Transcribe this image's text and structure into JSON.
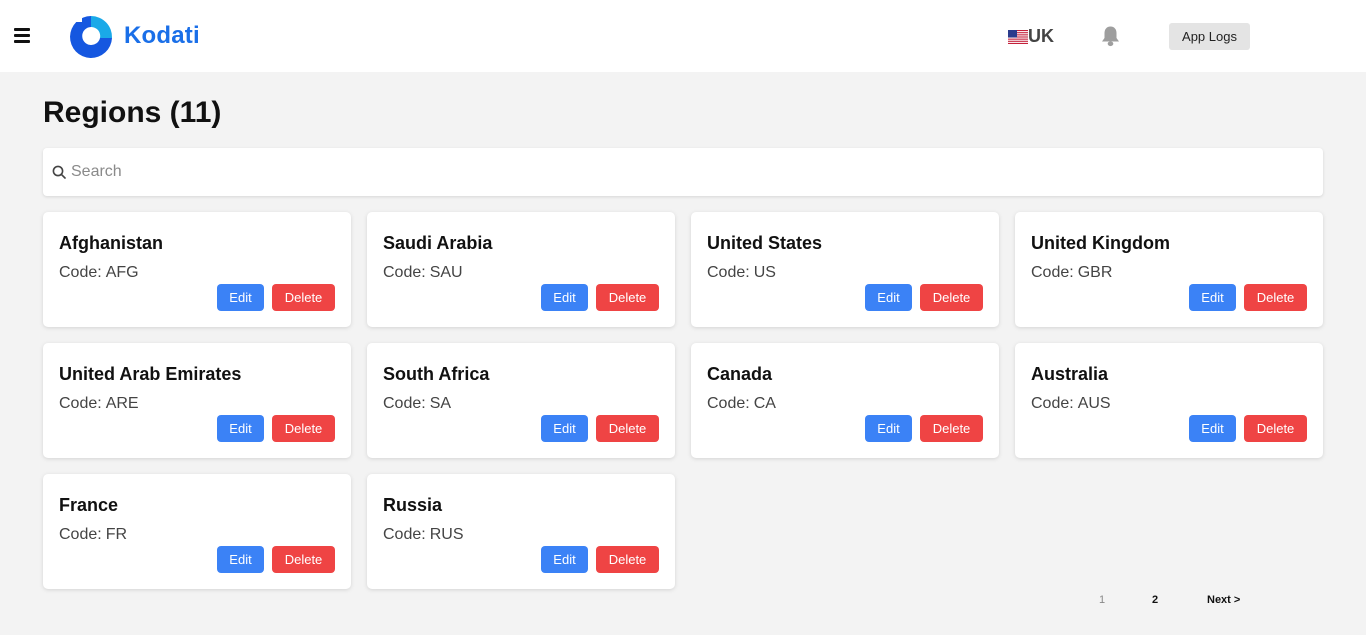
{
  "header": {
    "logo_text": "Kodati",
    "language_label": "UK",
    "app_logs_label": "App Logs",
    "icons": {
      "menu": "hamburger-menu-icon",
      "flag": "us-flag-icon",
      "notifications": "bell-icon"
    },
    "brand_color": "#1a6fe8"
  },
  "page": {
    "title": "Regions (11)"
  },
  "search": {
    "placeholder": "Search",
    "value": ""
  },
  "cards": [
    {
      "name": "Afghanistan",
      "code_label": "Code:",
      "code": "AFG",
      "edit_label": "Edit",
      "delete_label": "Delete"
    },
    {
      "name": "Saudi Arabia",
      "code_label": "Code:",
      "code": "SAU",
      "edit_label": "Edit",
      "delete_label": "Delete"
    },
    {
      "name": "United States",
      "code_label": "Code:",
      "code": "US",
      "edit_label": "Edit",
      "delete_label": "Delete"
    },
    {
      "name": "United Kingdom",
      "code_label": "Code:",
      "code": "GBR",
      "edit_label": "Edit",
      "delete_label": "Delete"
    },
    {
      "name": "United Arab Emirates",
      "code_label": "Code:",
      "code": "ARE",
      "edit_label": "Edit",
      "delete_label": "Delete"
    },
    {
      "name": "South Africa",
      "code_label": "Code:",
      "code": "SA",
      "edit_label": "Edit",
      "delete_label": "Delete"
    },
    {
      "name": "Canada",
      "code_label": "Code:",
      "code": "CA",
      "edit_label": "Edit",
      "delete_label": "Delete"
    },
    {
      "name": "Australia",
      "code_label": "Code:",
      "code": "AUS",
      "edit_label": "Edit",
      "delete_label": "Delete"
    },
    {
      "name": "France",
      "code_label": "Code:",
      "code": "FR",
      "edit_label": "Edit",
      "delete_label": "Delete"
    },
    {
      "name": "Russia",
      "code_label": "Code:",
      "code": "RUS",
      "edit_label": "Edit",
      "delete_label": "Delete"
    }
  ],
  "pagination": {
    "pages": [
      "1",
      "2"
    ],
    "current_page": "1",
    "next_label": "Next >"
  },
  "colors": {
    "edit_button": "#3b82f6",
    "delete_button": "#ef4444",
    "background": "#f3f3f3"
  }
}
